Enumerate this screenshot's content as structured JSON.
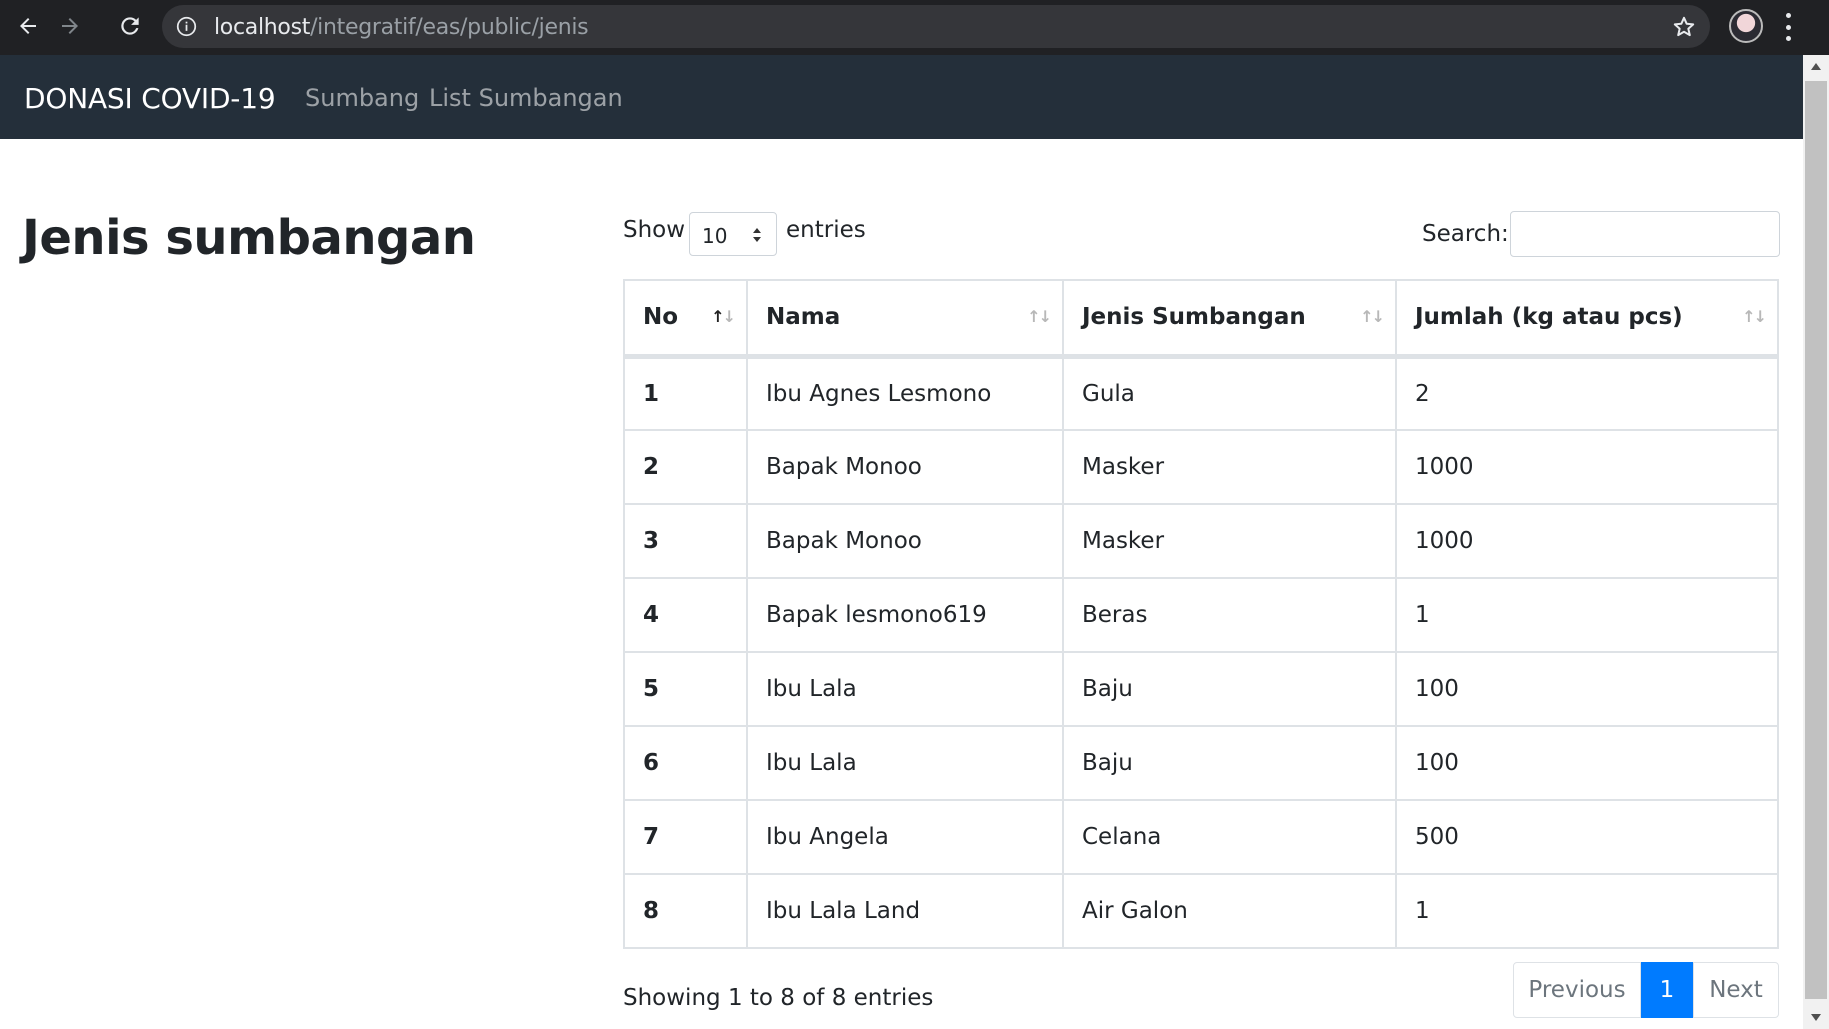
{
  "browser": {
    "url_host": "localhost",
    "url_path": "/integratif/eas/public/jenis"
  },
  "navbar": {
    "brand": "DONASI COVID-19",
    "links": [
      "Sumbang",
      "List Sumbangan"
    ]
  },
  "page": {
    "title": "Jenis sumbangan"
  },
  "datatable": {
    "length_prefix": "Show",
    "length_value": "10",
    "length_suffix": "entries",
    "search_label": "Search:",
    "search_value": "",
    "columns": [
      "No",
      "Nama",
      "Jenis Sumbangan",
      "Jumlah (kg atau pcs)"
    ],
    "rows": [
      [
        "1",
        "Ibu Agnes Lesmono",
        "Gula",
        "2"
      ],
      [
        "2",
        "Bapak Monoo",
        "Masker",
        "1000"
      ],
      [
        "3",
        "Bapak Monoo",
        "Masker",
        "1000"
      ],
      [
        "4",
        "Bapak lesmono619",
        "Beras",
        "1"
      ],
      [
        "5",
        "Ibu Lala",
        "Baju",
        "100"
      ],
      [
        "6",
        "Ibu Lala",
        "Baju",
        "100"
      ],
      [
        "7",
        "Ibu Angela",
        "Celana",
        "500"
      ],
      [
        "8",
        "Ibu Lala Land",
        "Air Galon",
        "1"
      ]
    ],
    "info": "Showing 1 to 8 of 8 entries",
    "pagination": {
      "previous": "Previous",
      "current": "1",
      "next": "Next"
    }
  },
  "colors": {
    "navbar_bg": "#242f3a",
    "chrome_bg": "#202124",
    "active_page": "#007bff"
  }
}
